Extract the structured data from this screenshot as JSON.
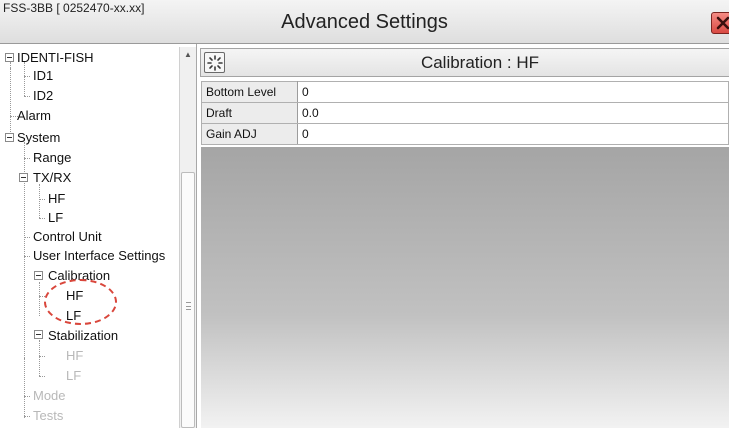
{
  "window": {
    "model_label": "FSS-3BB [ 0252470-xx.xx]",
    "title": "Advanced Settings"
  },
  "tree": {
    "items": [
      {
        "label": "IDENTI-FISH",
        "level": 0,
        "expandable": true,
        "enabled": true
      },
      {
        "label": "ID1",
        "level": 1,
        "expandable": false,
        "enabled": true
      },
      {
        "label": "ID2",
        "level": 1,
        "expandable": false,
        "enabled": true
      },
      {
        "label": "Alarm",
        "level": 0,
        "expandable": false,
        "enabled": true
      },
      {
        "label": "System",
        "level": 0,
        "expandable": true,
        "enabled": true
      },
      {
        "label": "Range",
        "level": 1,
        "expandable": false,
        "enabled": true
      },
      {
        "label": "TX/RX",
        "level": 1,
        "expandable": true,
        "enabled": true
      },
      {
        "label": "HF",
        "level": 2,
        "expandable": false,
        "enabled": true
      },
      {
        "label": "LF",
        "level": 2,
        "expandable": false,
        "enabled": true
      },
      {
        "label": "Control Unit",
        "level": 1,
        "expandable": false,
        "enabled": true
      },
      {
        "label": "User Interface Settings",
        "level": 1,
        "expandable": false,
        "enabled": true
      },
      {
        "label": "Calibration",
        "level": 1,
        "expandable": true,
        "enabled": true
      },
      {
        "label": "HF",
        "level": 2,
        "expandable": false,
        "enabled": true,
        "selected": true
      },
      {
        "label": "LF",
        "level": 2,
        "expandable": false,
        "enabled": true
      },
      {
        "label": "Stabilization",
        "level": 1,
        "expandable": true,
        "enabled": true
      },
      {
        "label": "HF",
        "level": 2,
        "expandable": false,
        "enabled": false
      },
      {
        "label": "LF",
        "level": 2,
        "expandable": false,
        "enabled": false
      },
      {
        "label": "Mode",
        "level": 1,
        "expandable": false,
        "enabled": false
      },
      {
        "label": "Tests",
        "level": 1,
        "expandable": false,
        "enabled": false
      }
    ]
  },
  "panel": {
    "title": "Calibration : HF",
    "rows": [
      {
        "label": "Bottom Level",
        "value": "0"
      },
      {
        "label": "Draft",
        "value": "0.0"
      },
      {
        "label": "Gain ADJ",
        "value": "0"
      }
    ]
  },
  "icons": {
    "close": "close-icon",
    "settings": "settings-icon",
    "expander": "tree-collapse-icon",
    "scroll_up": "scroll-up-arrow-icon"
  },
  "colors": {
    "close_button": "#e0554d",
    "highlight_circle": "#d9463b",
    "disabled_text": "#b8b8b8"
  }
}
